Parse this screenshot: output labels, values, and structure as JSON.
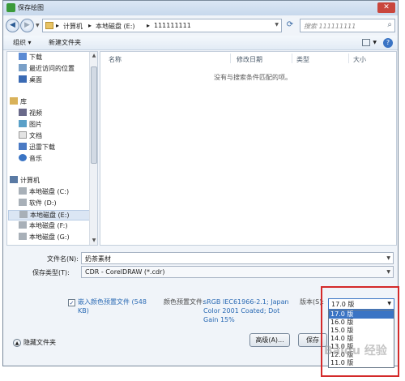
{
  "window": {
    "title": "保存绘图"
  },
  "nav": {
    "breadcrumbs": [
      "计算机",
      "本地磁盘 (E:)",
      "111111111"
    ],
    "search_placeholder": "搜索 111111111"
  },
  "toolbar": {
    "organize": "组织 ▾",
    "new_folder": "新建文件夹"
  },
  "sidebar": {
    "favorites": [
      "下载",
      "最近访问的位置",
      "桌面"
    ],
    "libraries_header": "库",
    "libraries": [
      "视频",
      "图片",
      "文档",
      "迅雷下载",
      "音乐"
    ],
    "computer_header": "计算机",
    "drives": [
      "本地磁盘 (C:)",
      "软件 (D:)",
      "本地磁盘 (E:)",
      "本地磁盘 (F:)",
      "本地磁盘 (G:)"
    ]
  },
  "file_list": {
    "columns": [
      "名称",
      "修改日期",
      "类型",
      "大小"
    ],
    "empty_message": "没有与搜索条件匹配的项。"
  },
  "form": {
    "filename_label": "文件名(N):",
    "filename_value": "奶茶素材",
    "filetype_label": "保存类型(T):",
    "filetype_value": "CDR - CorelDRAW (*.cdr)"
  },
  "options": {
    "embed_profile_label": "嵌入颜色预置文件 (548 KB)",
    "embed_profile_checked": true,
    "color_profile_label": "颜色预置文件:",
    "color_profile_value": "sRGB IEC61966-2.1; Japan Color 2001 Coated; Dot Gain 15%",
    "version_label": "版本(S):",
    "version_selected": "17.0 版",
    "version_options": [
      "17.0 版",
      "16.0 版",
      "15.0 版",
      "14.0 版",
      "13.0 版",
      "12.0 版",
      "11.0 版"
    ]
  },
  "buttons": {
    "advanced": "高级(A)...",
    "save": "保存",
    "hide_folders": "隐藏文件夹"
  },
  "watermark": "Baidu 经验"
}
